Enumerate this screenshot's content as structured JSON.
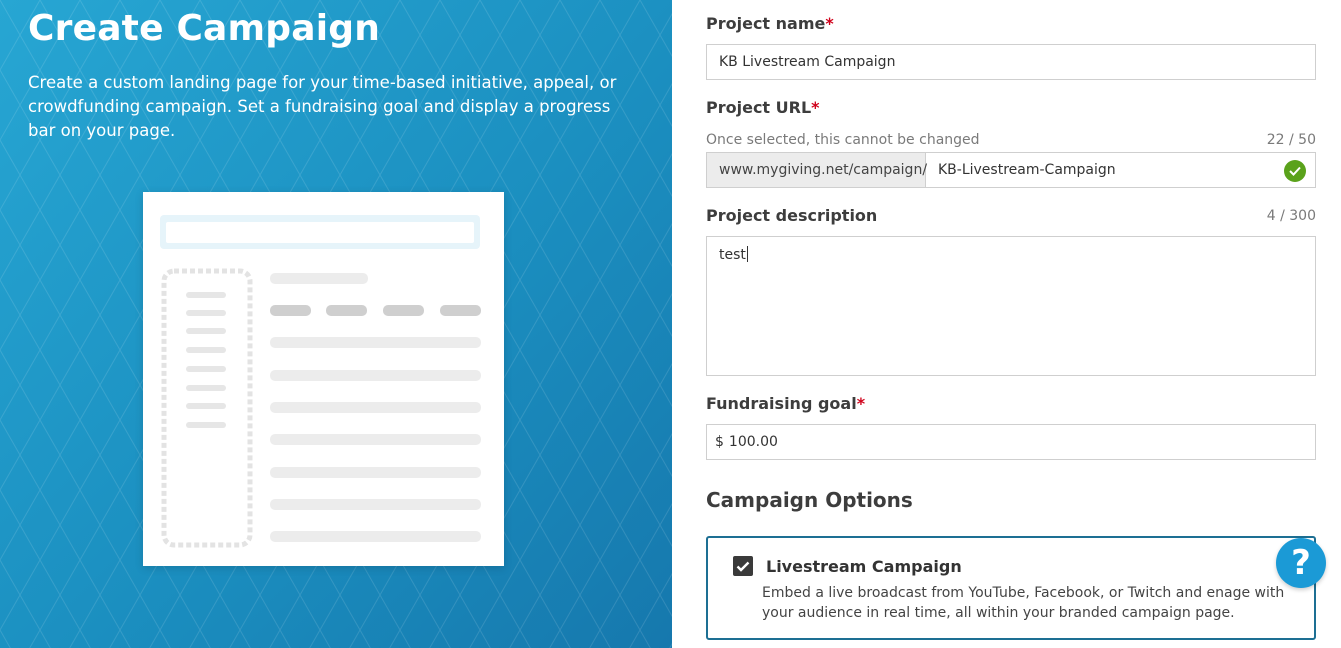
{
  "hero": {
    "title": "Create Campaign",
    "description": "Create a custom landing page for your time-based initiative, appeal, or crowdfunding campaign. Set a fundraising goal and display a progress bar on your page.",
    "illustration_icon": "landing-page-illustration"
  },
  "form": {
    "project_name": {
      "label": "Project name",
      "required_mark": "*",
      "value": "KB Livestream Campaign"
    },
    "project_url": {
      "label": "Project URL",
      "required_mark": "*",
      "hint": "Once selected, this cannot be changed",
      "counter": "22 / 50",
      "prefix": "www.mygiving.net/campaign/",
      "value": "KB-Livestream-Campaign",
      "status_icon": "check-circle-icon"
    },
    "project_description": {
      "label": "Project description",
      "counter": "4 / 300",
      "value": "test"
    },
    "fundraising_goal": {
      "label": "Fundraising goal",
      "required_mark": "*",
      "currency": "$",
      "value": "100.00"
    },
    "campaign_options": {
      "title": "Campaign Options",
      "options": [
        {
          "label": "Livestream Campaign",
          "checked": true,
          "description": "Embed a live broadcast from YouTube, Facebook, or Twitch and enage with your audience in real time, all within your branded campaign page."
        }
      ]
    }
  },
  "help": {
    "label": "?",
    "icon": "help-icon"
  },
  "colors": {
    "hero_bg": "#1b8fc0",
    "required": "#d0021b",
    "success": "#5aa21b",
    "card_border": "#1d6f93",
    "help_bg": "#1b9ad6"
  }
}
